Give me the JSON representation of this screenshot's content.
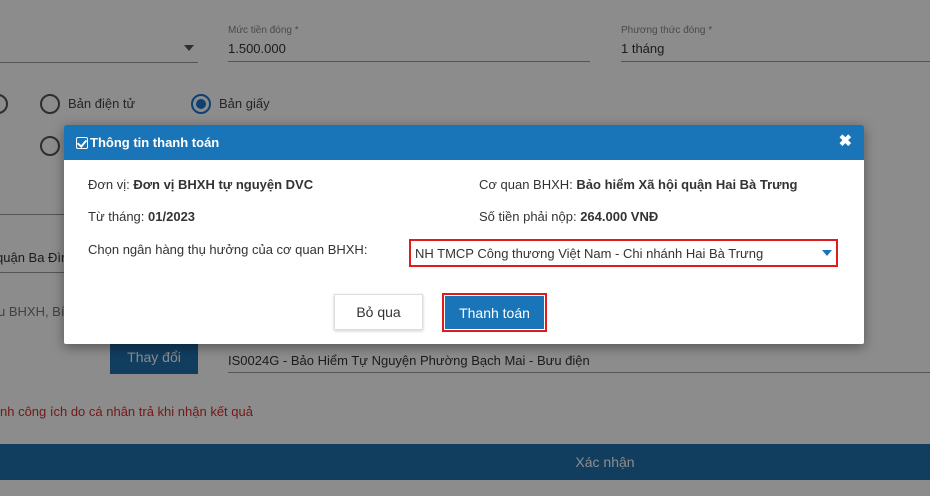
{
  "form": {
    "amount_label": "Mức tiền đóng *",
    "amount_value": "1.500.000",
    "method_label": "Phương thức đóng *",
    "method_value": "1 tháng",
    "radio_electronic": "Bản điện tử",
    "radio_paper": "Bản giấy",
    "partial_left_1": "quận Ba Đìn",
    "partial_left_2": "u BHXH, Bí",
    "change_button": "Thay đổi",
    "office_value": "IS0024G - Bảo Hiểm Tự Nguyện Phường Bạch Mai - Bưu điện",
    "note": "nh công ích do cá nhân trả khi nhận kết quả",
    "confirm_button": "Xác nhận"
  },
  "modal": {
    "title": "Thông tin thanh toán",
    "unit_label": "Đơn vị:",
    "unit_value": "Đơn vị BHXH tự nguyện DVC",
    "agency_label": "Cơ quan BHXH:",
    "agency_value": "Bảo hiểm Xã hội quận Hai Bà Trưng",
    "from_month_label": "Từ tháng:",
    "from_month_value": "01/2023",
    "amount_due_label": "Số tiền phải nộp:",
    "amount_due_value": "264.000 VNĐ",
    "bank_label": "Chọn ngân hàng thụ hưởng của cơ quan BHXH:",
    "bank_selected": "NH TMCP Công thương Việt Nam - Chi nhánh Hai Bà Trưng",
    "skip_button": "Bỏ qua",
    "pay_button": "Thanh toán",
    "close_symbol": "✖"
  }
}
